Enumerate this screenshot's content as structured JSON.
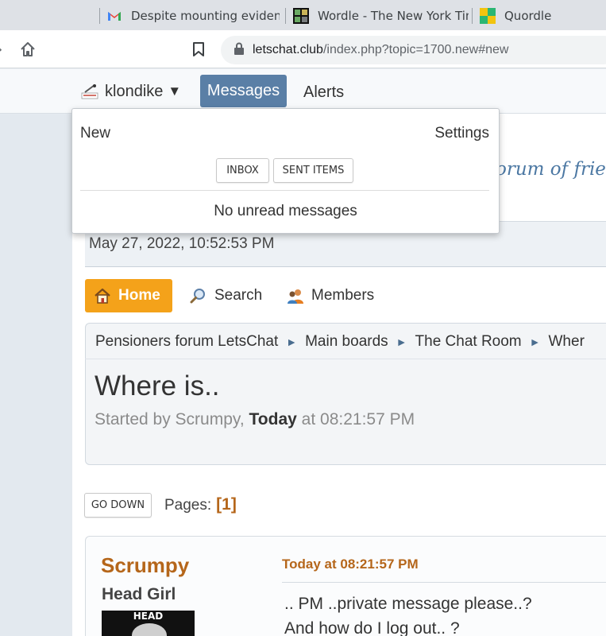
{
  "browser": {
    "tabs": [
      {
        "title": "Despite mounting evidence",
        "icon": "gmail-icon"
      },
      {
        "title": "Wordle - The New York Tim",
        "icon": "wordle-icon"
      },
      {
        "title": "Quordle",
        "icon": "quordle-icon"
      }
    ],
    "url_host": "letschat.club",
    "url_rest": "/index.php?topic=1700.new#new"
  },
  "header": {
    "username": "klondike",
    "caret": "▼",
    "messages_label": "Messages",
    "alerts_label": "Alerts",
    "tagline": "orum of frien",
    "accent_color": "#5a7fa6"
  },
  "messages_dropdown": {
    "new_label": "New",
    "settings_label": "Settings",
    "inbox_label": "INBOX",
    "sent_label": "SENT ITEMS",
    "empty_text": "No unread messages"
  },
  "datebar": {
    "date": "May 27, 2022, 10:52:53 PM"
  },
  "nav": {
    "home": "Home",
    "search": "Search",
    "members": "Members",
    "home_color": "#f4a21a"
  },
  "breadcrumb": {
    "items": [
      "Pensioners forum LetsChat",
      "Main boards",
      "The Chat Room",
      "Wher"
    ],
    "separator": "►"
  },
  "topic": {
    "title": "Where is..",
    "started_prefix": "Started by Scrumpy,",
    "started_day": "Today",
    "started_time": "at 08:21:57 PM"
  },
  "pagination": {
    "go_down": "GO DOWN",
    "pages_label": "Pages:",
    "current_page": "[1]"
  },
  "post": {
    "poster": "Scrumpy",
    "rank": "Head Girl",
    "avatar_label": "HEAD",
    "date": "Today at 08:21:57 PM",
    "lines": [
      ".. PM ..private message please..?",
      "And how do I log out.. ?"
    ]
  }
}
